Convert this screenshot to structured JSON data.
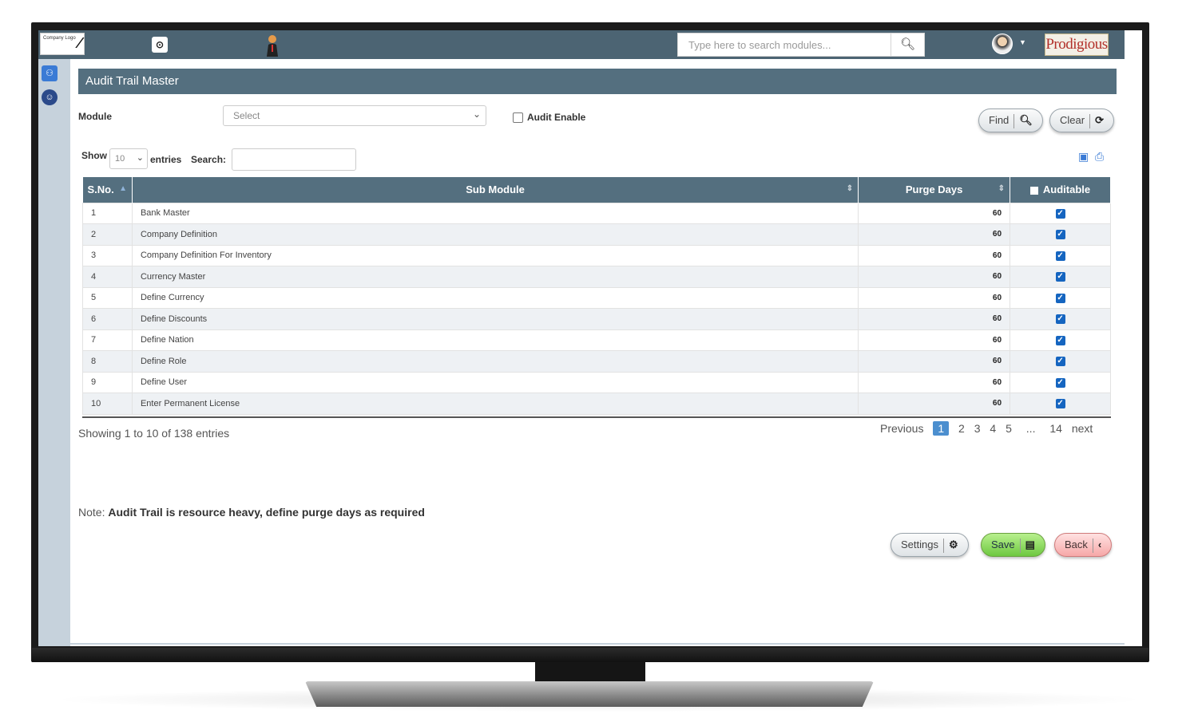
{
  "header": {
    "logo_text": "Company Logo",
    "search_placeholder": "Type here to search modules...",
    "brand": "Prodigious"
  },
  "page": {
    "title": "Audit Trail Master",
    "module_label": "Module",
    "module_value": "Select",
    "audit_enable_label": "Audit Enable",
    "find_label": "Find",
    "clear_label": "Clear"
  },
  "table_controls": {
    "show_label": "Show",
    "entries_value": "10",
    "entries_label": "entries",
    "search_label": "Search:"
  },
  "table": {
    "columns": [
      "S.No.",
      "Sub Module",
      "Purge Days",
      "Auditable"
    ],
    "rows": [
      {
        "sno": "1",
        "sub_module": "Bank Master",
        "purge_days": "60",
        "auditable": true
      },
      {
        "sno": "2",
        "sub_module": "Company Definition",
        "purge_days": "60",
        "auditable": true
      },
      {
        "sno": "3",
        "sub_module": "Company Definition For Inventory",
        "purge_days": "60",
        "auditable": true
      },
      {
        "sno": "4",
        "sub_module": "Currency Master",
        "purge_days": "60",
        "auditable": true
      },
      {
        "sno": "5",
        "sub_module": "Define Currency",
        "purge_days": "60",
        "auditable": true
      },
      {
        "sno": "6",
        "sub_module": "Define Discounts",
        "purge_days": "60",
        "auditable": true
      },
      {
        "sno": "7",
        "sub_module": "Define Nation",
        "purge_days": "60",
        "auditable": true
      },
      {
        "sno": "8",
        "sub_module": "Define Role",
        "purge_days": "60",
        "auditable": true
      },
      {
        "sno": "9",
        "sub_module": "Define User",
        "purge_days": "60",
        "auditable": true
      },
      {
        "sno": "10",
        "sub_module": "Enter Permanent License",
        "purge_days": "60",
        "auditable": true
      }
    ]
  },
  "footer": {
    "showing": "Showing 1 to 10 of 138 entries",
    "pagination": [
      "Previous",
      "1",
      "2",
      "3",
      "4",
      "5",
      "...",
      "14",
      "next"
    ],
    "note_prefix": "Note:",
    "note_text": "Audit Trail is resource heavy, define purge days as required",
    "settings_label": "Settings",
    "save_label": "Save",
    "back_label": "Back"
  },
  "colors": {
    "header_bg": "#4c6473",
    "title_bg": "#546f7f",
    "save": "#6ec840",
    "back": "#f6a8a8"
  }
}
